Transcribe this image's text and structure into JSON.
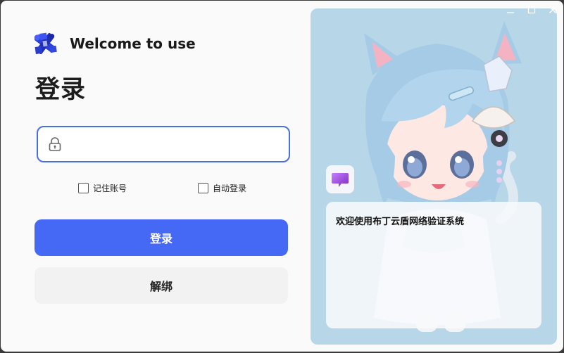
{
  "brand": {
    "title": "Welcome to use",
    "logo": "puzzle-x-logo"
  },
  "page": {
    "title": "登录"
  },
  "form": {
    "password_value": "",
    "password_icon": "lock-icon",
    "remember_label": "记住账号",
    "remember_checked": false,
    "auto_login_label": "自动登录",
    "auto_login_checked": false,
    "login_label": "登录",
    "unbind_label": "解绑"
  },
  "panel": {
    "chat_icon": "chat-bubble-icon",
    "message": "欢迎使用布丁云盾网络验证系统"
  },
  "window": {
    "controls": [
      "minimize-icon",
      "maximize-icon",
      "close-icon"
    ]
  },
  "colors": {
    "accent": "#4568f5",
    "input_border": "#4a6fe0",
    "panel_bg": "#b7d6e7",
    "secondary_button": "#f2f2f2",
    "chat_icon": "#9b5de5"
  }
}
